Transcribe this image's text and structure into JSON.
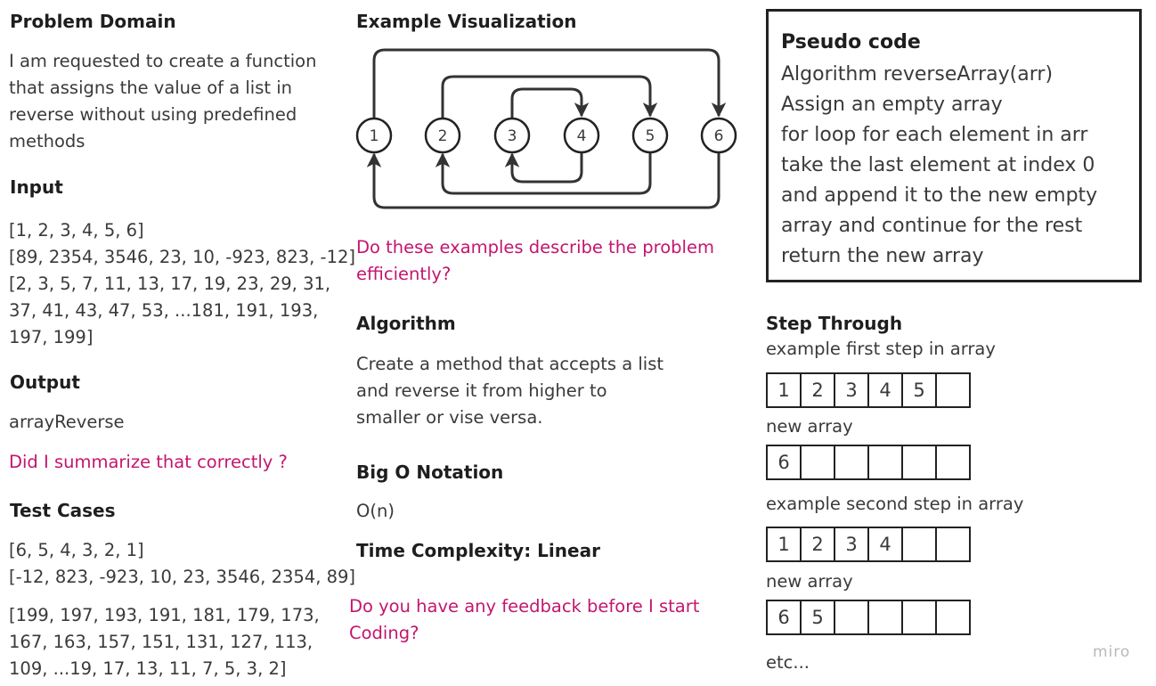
{
  "problem_domain": {
    "heading": "Problem Domain",
    "lines": [
      "I am requested to create a function",
      "that assigns the value of a list in",
      "reverse without using predefined",
      "methods"
    ]
  },
  "input": {
    "heading": "Input",
    "lines": [
      "[1, 2, 3, 4, 5, 6]",
      "[89, 2354, 3546, 23, 10, -923, 823, -12]",
      "[2, 3, 5, 7, 11, 13, 17, 19, 23, 29, 31,",
      "37, 41, 43, 47, 53, ...181, 191, 193,",
      "197, 199]"
    ]
  },
  "output": {
    "heading": "Output",
    "value": "arrayReverse"
  },
  "summary_question": "Did I summarize that correctly ?",
  "test_cases": {
    "heading": "Test Cases",
    "lines_a": [
      "[6, 5, 4, 3, 2, 1]",
      "[-12, 823, -923, 10, 23, 3546, 2354, 89]"
    ],
    "lines_b": [
      "[199, 197, 193, 191, 181, 179, 173,",
      "167, 163, 157, 151, 131, 127, 113,",
      "109, ...19, 17, 13, 11, 7, 5, 3, 2]"
    ]
  },
  "example_visualization": {
    "heading": "Example Visualization",
    "nodes": [
      "1",
      "2",
      "3",
      "4",
      "5",
      "6"
    ]
  },
  "examples_question": [
    "Do these examples describe the problem",
    "efficiently?"
  ],
  "algorithm": {
    "heading": "Algorithm",
    "lines": [
      "Create a method that accepts a list",
      "and reverse it from higher to",
      "smaller or vise versa."
    ]
  },
  "big_o": {
    "heading": "Big O Notation",
    "value": "O(n)"
  },
  "time_complexity": "Time Complexity: Linear",
  "feedback_question": [
    "Do you have any feedback before I start",
    "Coding?"
  ],
  "pseudo_code": {
    "title": "Pseudo code",
    "lines": [
      "Algorithm reverseArray(arr)",
      "Assign an empty array",
      "for loop for each element in arr",
      "take the last element at index 0",
      "and append it to the new empty",
      "array and continue for the rest",
      "return the new array"
    ]
  },
  "step_through": {
    "heading": "Step Through",
    "step1_label": "example first step in array",
    "step1_cells": [
      "1",
      "2",
      "3",
      "4",
      "5",
      ""
    ],
    "new_array_label_1": "new array",
    "new1_cells": [
      "6",
      "",
      "",
      "",
      "",
      ""
    ],
    "step2_label": "example second step in array",
    "step2_cells": [
      "1",
      "2",
      "3",
      "4",
      "",
      ""
    ],
    "new_array_label_2": "new array",
    "new2_cells": [
      "6",
      "5",
      "",
      "",
      "",
      ""
    ],
    "etc": "etc..."
  },
  "watermark": "miro"
}
